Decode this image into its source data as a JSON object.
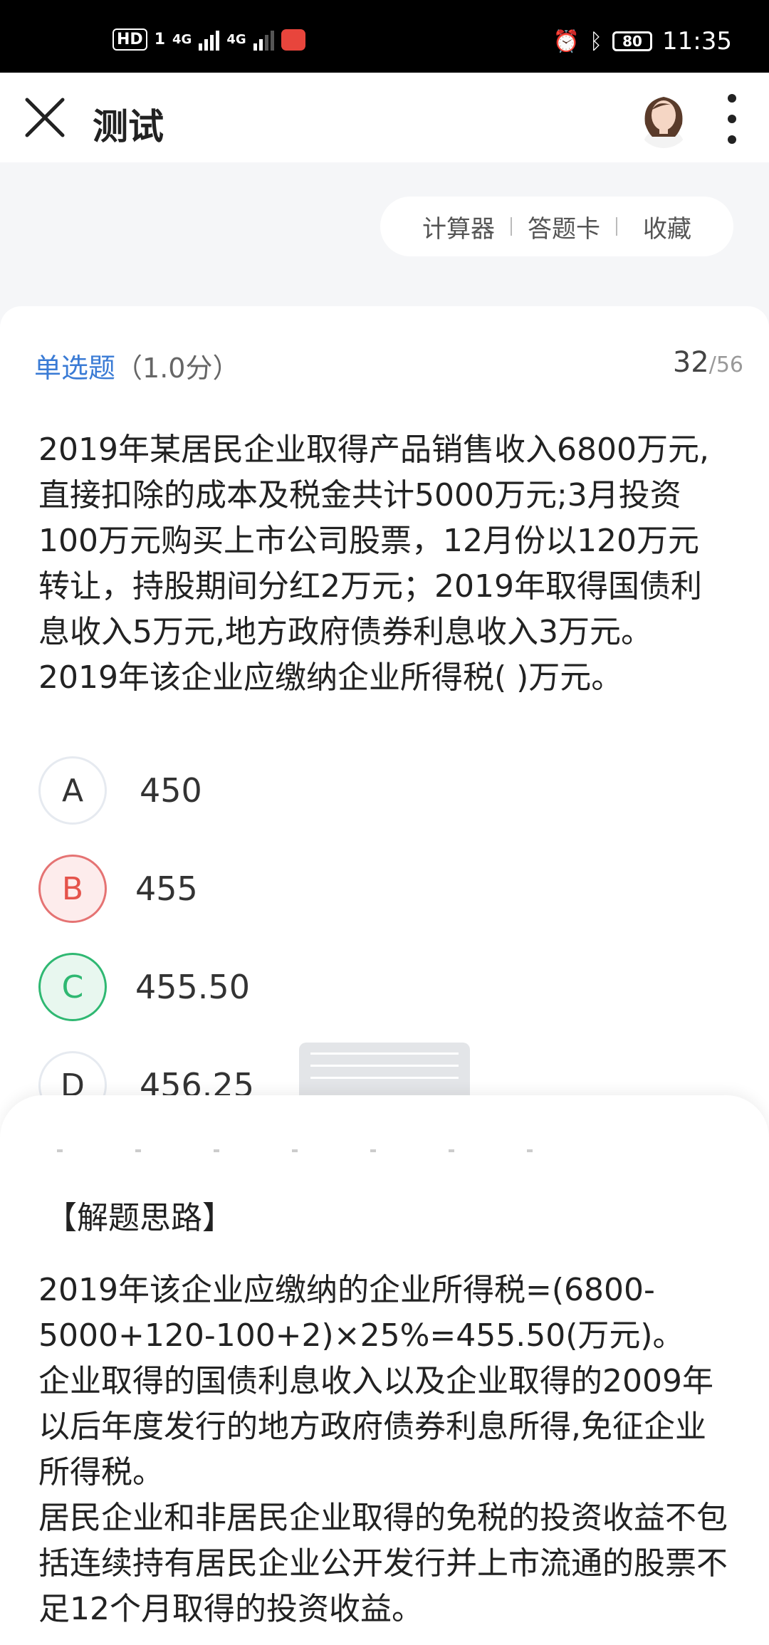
{
  "status_bar": {
    "hd": "HD",
    "sim": "1",
    "net1": "4G",
    "net2": "4G",
    "battery": "80",
    "time": "11:35"
  },
  "header": {
    "title": "测试"
  },
  "tools": {
    "calculator": "计算器",
    "answer_card": "答题卡",
    "favorite": "收藏"
  },
  "question": {
    "type": "单选题",
    "score": "（1.0分）",
    "current": "32",
    "total": "/56",
    "text": "2019年某居民企业取得产品销售收入6800万元,直接扣除的成本及税金共计5000万元;3月投资100万元购买上市公司股票，12月份以120万元转让，持股期间分红2万元；2019年取得国债利息收入5万元,地方政府债券利息收入3万元。2019年该企业应缴纳企业所得税( )万元。",
    "options": [
      {
        "letter": "A",
        "text": "450"
      },
      {
        "letter": "B",
        "text": "455"
      },
      {
        "letter": "C",
        "text": "455.50"
      },
      {
        "letter": "D",
        "text": "456.25"
      }
    ]
  },
  "analysis": {
    "title": "【解题思路】",
    "p1": "2019年该企业应缴纳的企业所得税=(6800-5000+120-100+2)×25%=455.50(万元)。",
    "p2": "企业取得的国债利息收入以及企业取得的2009年以后年度发行的地方政府债券利息所得,免征企业所得税。",
    "p3": "居民企业和非居民企业取得的免税的投资收益不包括连续持有居民企业公开发行并上市流通的股票不足12个月取得的投资收益。"
  }
}
